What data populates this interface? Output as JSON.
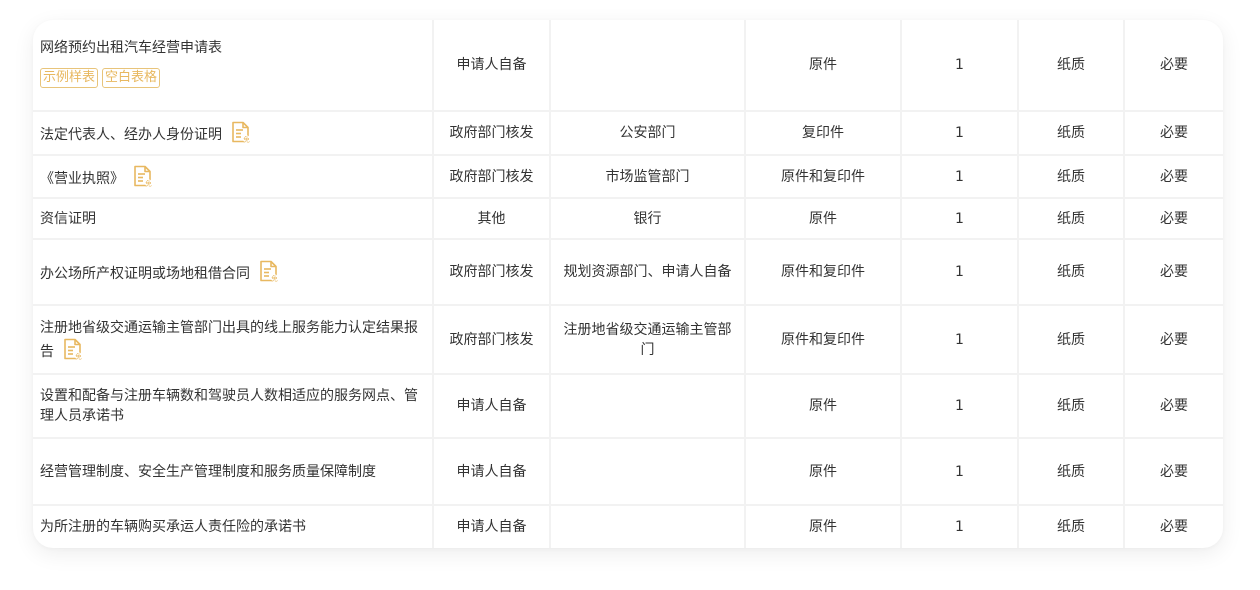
{
  "accent_color": "#e8b860",
  "materials": [
    {
      "name": "网络预约出租汽车经营申请表",
      "source": "申请人自备",
      "issuer": "",
      "form": "原件",
      "count": "1",
      "medium": "纸质",
      "required": "必要",
      "badges": [
        "示例样表",
        "空白表格"
      ],
      "has_icon": false
    },
    {
      "name": "法定代表人、经办人身份证明",
      "source": "政府部门核发",
      "issuer": "公安部门",
      "form": "复印件",
      "count": "1",
      "medium": "纸质",
      "required": "必要",
      "has_icon": true,
      "icon": "exempt-document-icon"
    },
    {
      "name": "《营业执照》",
      "source": "政府部门核发",
      "issuer": "市场监管部门",
      "form": "原件和复印件",
      "count": "1",
      "medium": "纸质",
      "required": "必要",
      "has_icon": true,
      "icon": "exempt-document-icon"
    },
    {
      "name": "资信证明",
      "source": "其他",
      "issuer": "银行",
      "form": "原件",
      "count": "1",
      "medium": "纸质",
      "required": "必要",
      "has_icon": false
    },
    {
      "name": "办公场所产权证明或场地租借合同",
      "source": "政府部门核发",
      "issuer": "规划资源部门、申请人自备",
      "form": "原件和复印件",
      "count": "1",
      "medium": "纸质",
      "required": "必要",
      "has_icon": true,
      "icon": "exempt-document-icon"
    },
    {
      "name": "注册地省级交通运输主管部门出具的线上服务能力认定结果报告",
      "source": "政府部门核发",
      "issuer": "注册地省级交通运输主管部门",
      "form": "原件和复印件",
      "count": "1",
      "medium": "纸质",
      "required": "必要",
      "has_icon": true,
      "icon": "exempt-document-icon"
    },
    {
      "name": "设置和配备与注册车辆数和驾驶员人数相适应的服务网点、管理人员承诺书",
      "source": "申请人自备",
      "issuer": "",
      "form": "原件",
      "count": "1",
      "medium": "纸质",
      "required": "必要",
      "has_icon": false
    },
    {
      "name": "经营管理制度、安全生产管理制度和服务质量保障制度",
      "source": "申请人自备",
      "issuer": "",
      "form": "原件",
      "count": "1",
      "medium": "纸质",
      "required": "必要",
      "has_icon": false
    },
    {
      "name": "为所注册的车辆购买承运人责任险的承诺书",
      "source": "申请人自备",
      "issuer": "",
      "form": "原件",
      "count": "1",
      "medium": "纸质",
      "required": "必要",
      "has_icon": false
    }
  ]
}
